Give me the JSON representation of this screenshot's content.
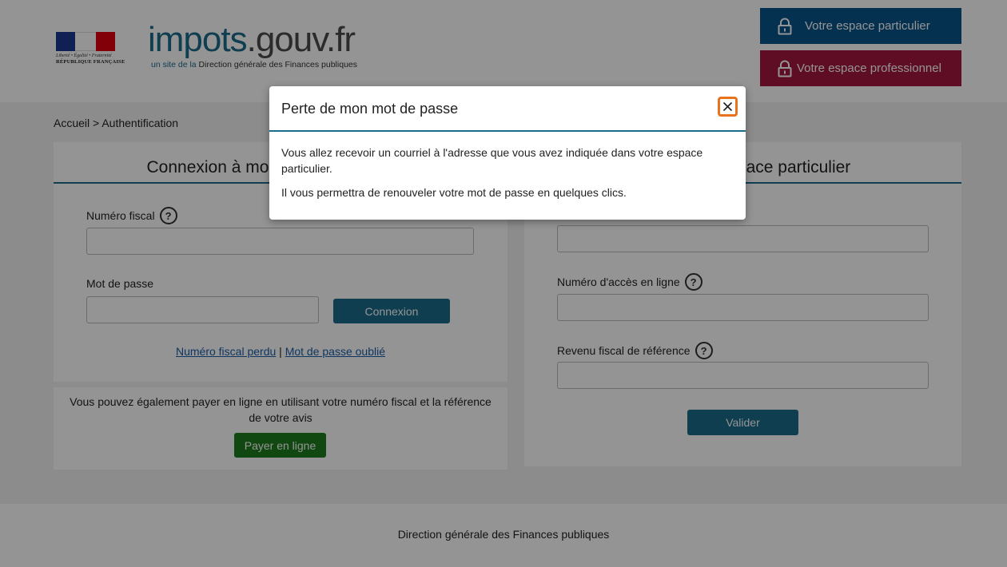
{
  "header": {
    "marianne": {
      "motto": "Liberté • Égalité • Fraternité",
      "republic": "RÉPUBLIQUE FRANÇAISE"
    },
    "brand": {
      "part1": "impots",
      "part2": ".gouv.fr"
    },
    "tagline": {
      "prefix": "un site de la",
      "rest": " Direction générale des Finances publiques"
    },
    "particulier_label": "Votre espace particulier",
    "professionnel_label": "Votre espace professionnel",
    "colors": {
      "particulier": "#0a558c",
      "professionnel": "#a4173e",
      "brand": "#1a6b8c"
    }
  },
  "breadcrumb": {
    "home": "Accueil",
    "separator": " > ",
    "current": "Authentification"
  },
  "login_panel": {
    "title": "Connexion à mon espace particulier",
    "fiscal_label": "Numéro fiscal",
    "fiscal_value": "",
    "password_label": "Mot de passe",
    "password_value": "",
    "connect_label": "Connexion",
    "lost_fiscal_link": "Numéro fiscal perdu",
    "link_separator": " | ",
    "forgot_password_link": "Mot de passe oublié"
  },
  "pay_panel": {
    "text": "Vous pouvez également payer en ligne en utilisant votre numéro fiscal et la référence de votre avis",
    "button_label": "Payer en ligne"
  },
  "create_panel": {
    "title": "Créer mon espace particulier",
    "access_label": "Numéro d'accès en ligne",
    "revenue_label": "Revenu fiscal de référence",
    "validate_label": "Valider"
  },
  "footer": {
    "text": "Direction générale des Finances publiques"
  },
  "modal": {
    "title": "Perte de mon mot de passe",
    "paragraph1": "Vous allez recevoir un courriel à l'adresse que vous avez indiquée dans votre espace particulier.",
    "paragraph2": "Il vous permettra de renouveler votre mot de passe en quelques clics.",
    "close_icon": "close-icon"
  },
  "help_glyph": "?"
}
